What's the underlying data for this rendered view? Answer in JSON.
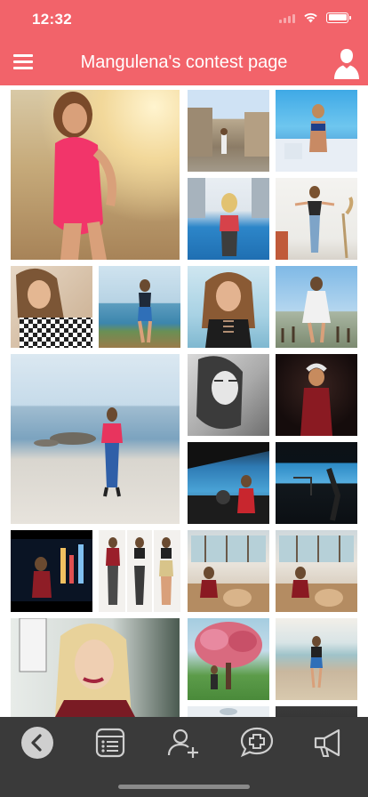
{
  "status_bar": {
    "time": "12:32"
  },
  "header": {
    "title": "Mangulena's contest page",
    "menu_icon": "hamburger-icon",
    "profile_icon": "user-silhouette-icon"
  },
  "colors": {
    "header": "#f2636a",
    "tabbar": "#3a3a3a",
    "icon": "#d0d0d0"
  },
  "photos": [
    {
      "name": "photo-pink-dress-beach"
    },
    {
      "name": "photo-street-old-town"
    },
    {
      "name": "photo-pool-bikini"
    },
    {
      "name": "photo-poolside-red-top"
    },
    {
      "name": "photo-white-room-dancing"
    },
    {
      "name": "photo-checked-shirt-portrait"
    },
    {
      "name": "photo-seaside-blue-top"
    },
    {
      "name": "photo-black-top-sea"
    },
    {
      "name": "photo-white-dress-pier"
    },
    {
      "name": "photo-beach-pink-sweater"
    },
    {
      "name": "photo-black-white-portrait"
    },
    {
      "name": "photo-dark-red-outfit"
    },
    {
      "name": "photo-window-sea-view"
    },
    {
      "name": "photo-dark-window-city"
    },
    {
      "name": "photo-night-city"
    },
    {
      "name": "photo-triptych-outfits"
    },
    {
      "name": "photo-restaurant-1"
    },
    {
      "name": "photo-restaurant-2"
    },
    {
      "name": "photo-blonde-portrait"
    },
    {
      "name": "photo-blossom-tree"
    },
    {
      "name": "photo-beach-black-top"
    },
    {
      "name": "photo-partial-bottom-1"
    },
    {
      "name": "photo-partial-bottom-2"
    }
  ],
  "tabs": [
    {
      "name": "back",
      "icon": "chevron-left-icon"
    },
    {
      "name": "list",
      "icon": "list-icon"
    },
    {
      "name": "add-user",
      "icon": "add-user-icon"
    },
    {
      "name": "vote",
      "icon": "chat-plus-icon"
    },
    {
      "name": "announce",
      "icon": "megaphone-icon"
    }
  ]
}
